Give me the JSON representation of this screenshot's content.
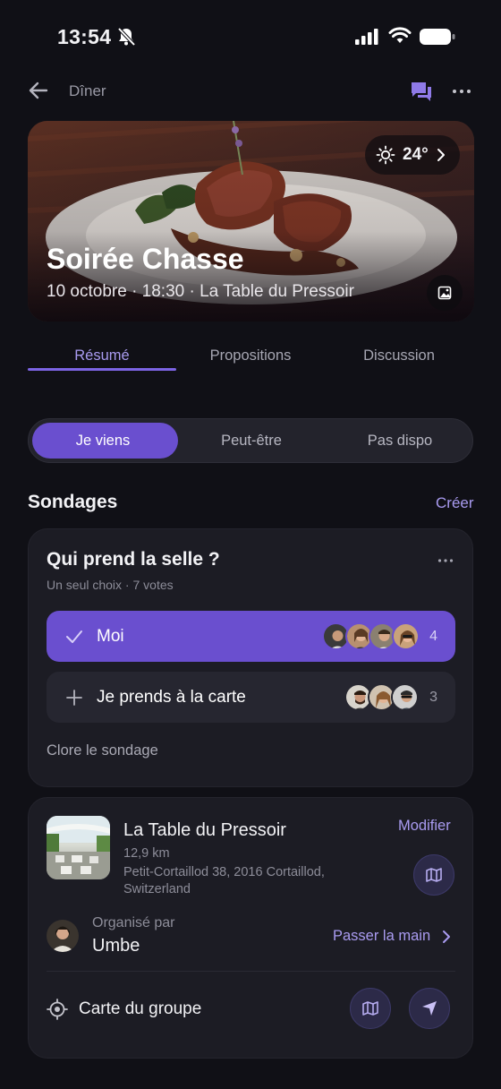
{
  "status_bar": {
    "time": "13:54"
  },
  "nav": {
    "title": "Dîner"
  },
  "hero": {
    "title": "Soirée Chasse",
    "subtitle": "10 octobre · 18:30 · La Table du Pressoir",
    "weather": {
      "temperature": "24°",
      "icon": "sun-icon"
    }
  },
  "tabs": [
    {
      "label": "Résumé",
      "active": true
    },
    {
      "label": "Propositions",
      "active": false
    },
    {
      "label": "Discussion",
      "active": false
    }
  ],
  "rsvp": {
    "options": [
      "Je viens",
      "Peut-être",
      "Pas dispo"
    ],
    "selected": "Je viens"
  },
  "polls": {
    "section_title": "Sondages",
    "create_label": "Créer",
    "poll": {
      "question": "Qui prend la selle ?",
      "meta": "Un seul choix · 7 votes",
      "options": [
        {
          "label": "Moi",
          "count": "4",
          "selected": true,
          "icon": "check-icon"
        },
        {
          "label": "Je prends à la carte",
          "count": "3",
          "selected": false,
          "icon": "plus-icon"
        }
      ],
      "close_label": "Clore le sondage"
    }
  },
  "venue": {
    "name": "La Table du Pressoir",
    "distance": "12,9 km",
    "address": "Petit-Cortaillod 38, 2016 Cortaillod, Switzerland",
    "modify_label": "Modifier",
    "organizer_label": "Organisé par",
    "organizer_name": "Umbe",
    "handover_label": "Passer la main",
    "group_map_label": "Carte du groupe"
  },
  "colors": {
    "accent": "#6a4fcf",
    "accent_text": "#a99bf0",
    "background": "#101016",
    "card": "#1c1c24"
  }
}
